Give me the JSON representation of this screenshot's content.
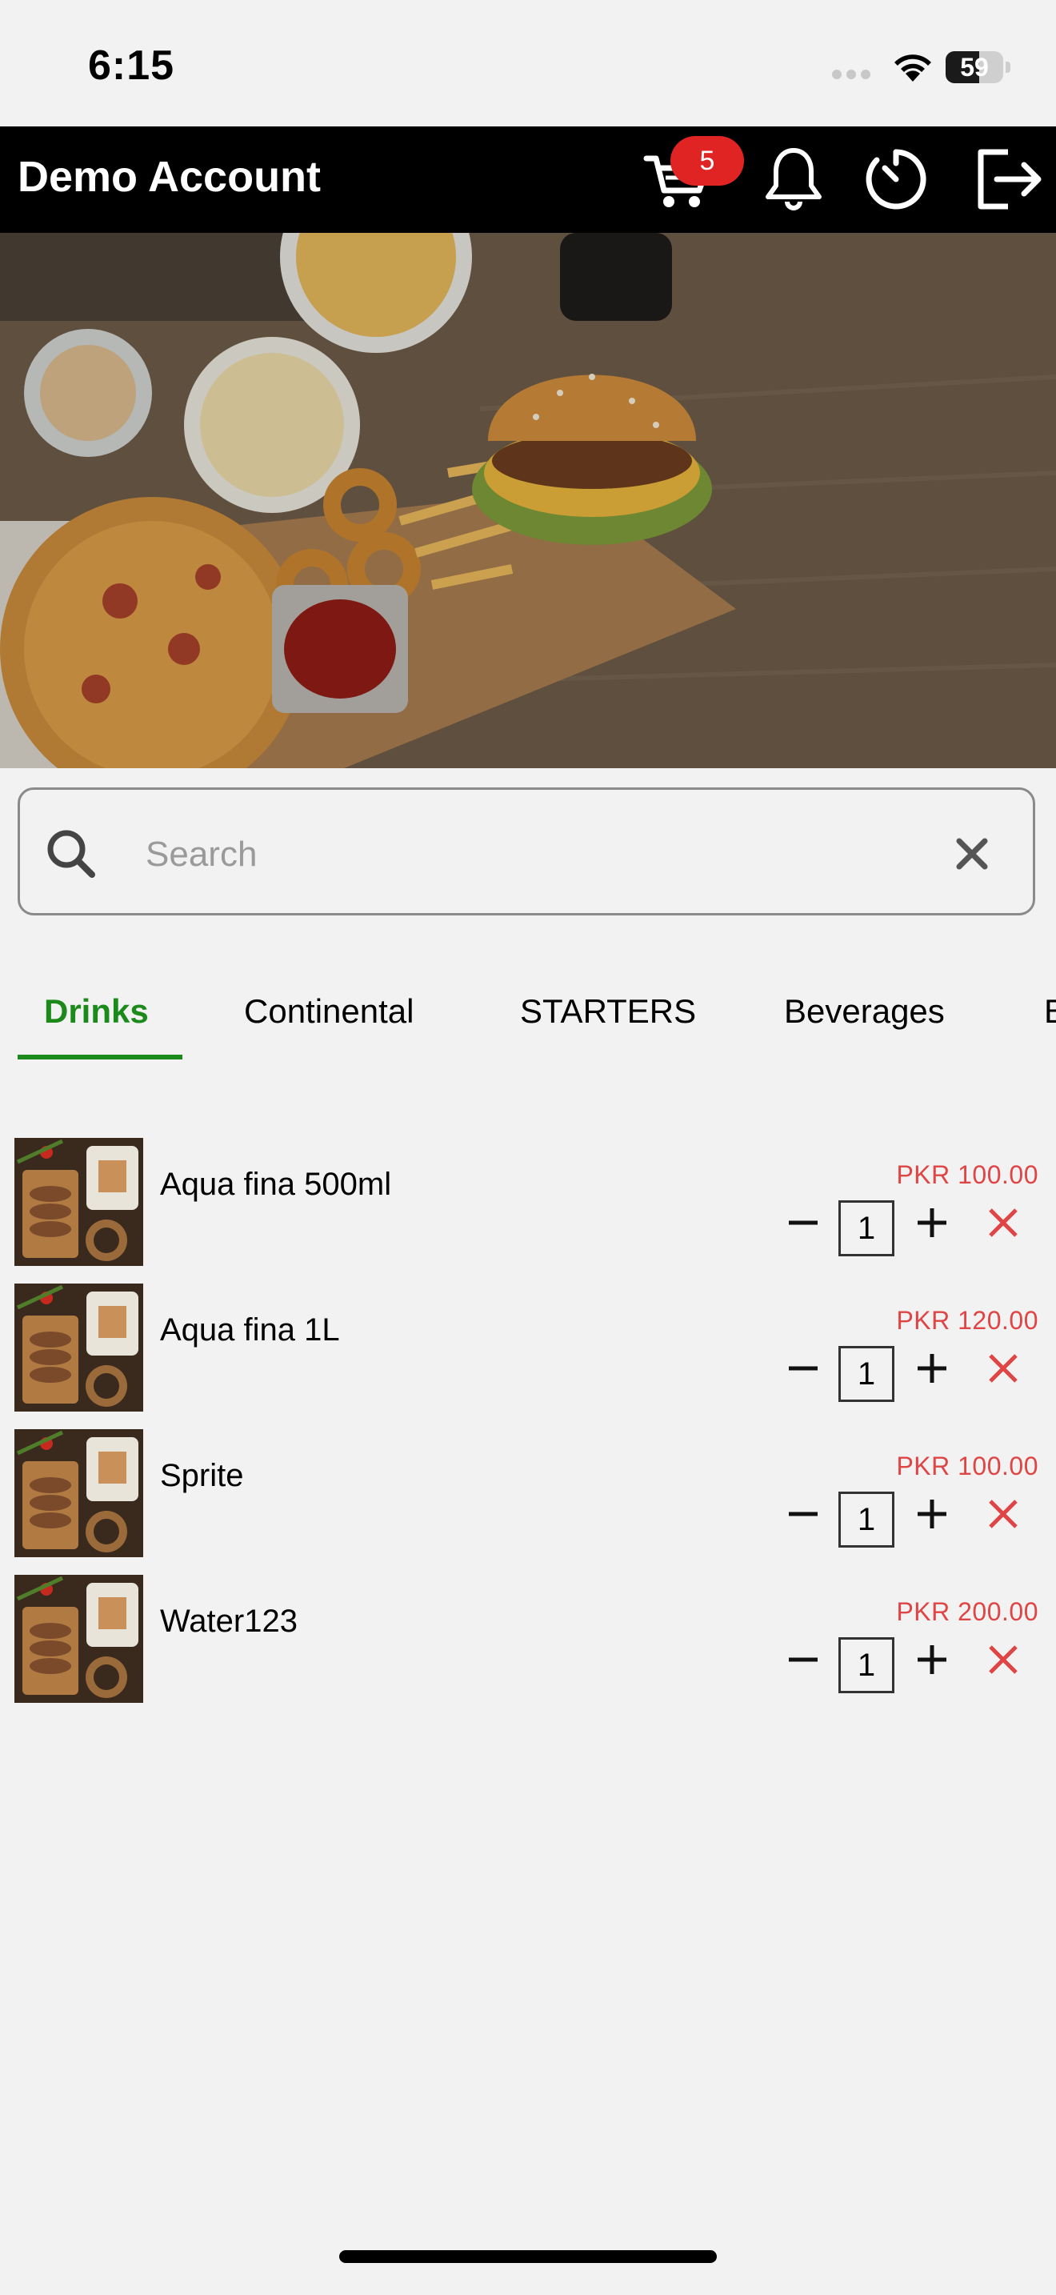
{
  "status_bar": {
    "time": "6:15",
    "battery": "59",
    "battery_level": 0.59
  },
  "header": {
    "title": "Demo Account",
    "cart_count": "5",
    "icons": [
      "cart-icon",
      "bell-icon",
      "timer-icon",
      "logout-icon"
    ]
  },
  "search": {
    "placeholder": "Search",
    "value": ""
  },
  "tabs": [
    {
      "label": "Drinks",
      "active": true
    },
    {
      "label": "Continental",
      "active": false
    },
    {
      "label": "STARTERS",
      "active": false
    },
    {
      "label": "Beverages",
      "active": false
    },
    {
      "label": "B",
      "active": false
    }
  ],
  "items": [
    {
      "name": "Aqua fina 500ml",
      "price": "PKR 100.00",
      "qty": "1"
    },
    {
      "name": "Aqua fina 1L",
      "price": "PKR 120.00",
      "qty": "1"
    },
    {
      "name": "Sprite",
      "price": "PKR 100.00",
      "qty": "1"
    },
    {
      "name": "Water123",
      "price": "PKR 200.00",
      "qty": "1"
    }
  ],
  "colors": {
    "accent": "#1b8a1b",
    "price": "#e04545",
    "badge": "#e02424",
    "header_bg": "#000000"
  }
}
